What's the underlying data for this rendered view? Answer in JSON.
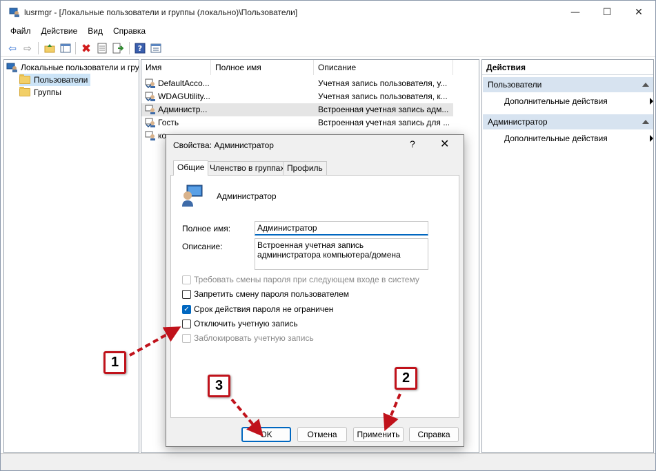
{
  "window": {
    "title": "lusrmgr - [Локальные пользователи и группы (локально)\\Пользователи]",
    "minimize": "—",
    "maximize": "☐",
    "close": "✕"
  },
  "menu": [
    "Файл",
    "Действие",
    "Вид",
    "Справка"
  ],
  "toolbar": {
    "icons": [
      "back-icon",
      "forward-icon",
      "up-folder-icon",
      "show-tree-icon",
      "delete-icon",
      "properties-icon",
      "export-icon",
      "help-icon",
      "view-icon"
    ]
  },
  "tree": {
    "root": "Локальные пользователи и гру",
    "items": [
      "Пользователи",
      "Группы"
    ]
  },
  "list": {
    "columns": [
      "Имя",
      "Полное имя",
      "Описание"
    ],
    "rows": [
      {
        "name": "DefaultAcco...",
        "fullname": "",
        "description": "Учетная запись пользователя, у..."
      },
      {
        "name": "WDAGUtility...",
        "fullname": "",
        "description": "Учетная запись пользователя, к..."
      },
      {
        "name": "Администр...",
        "fullname": "",
        "description": "Встроенная учетная запись адм..."
      },
      {
        "name": "Гость",
        "fullname": "",
        "description": "Встроенная учетная запись для ..."
      },
      {
        "name": "ко",
        "fullname": "",
        "description": ""
      }
    ]
  },
  "actions": {
    "title": "Действия",
    "sections": [
      {
        "header": "Пользователи",
        "item": "Дополнительные действия"
      },
      {
        "header": "Администратор",
        "item": "Дополнительные действия"
      }
    ]
  },
  "dialog": {
    "title": "Свойства: Администратор",
    "help": "?",
    "close": "✕",
    "tabs": [
      "Общие",
      "Членство в группах",
      "Профиль"
    ],
    "username": "Администратор",
    "fullname_label": "Полное имя:",
    "fullname_value": "Администратор",
    "description_label": "Описание:",
    "description_value": "Встроенная учетная запись администратора компьютера/домена",
    "checkboxes": [
      {
        "label": "Требовать смены пароля при следующем входе в систему",
        "checked": false,
        "disabled": true
      },
      {
        "label": "Запретить смену пароля пользователем",
        "checked": false,
        "disabled": false
      },
      {
        "label": "Срок действия пароля не ограничен",
        "checked": true,
        "disabled": false
      },
      {
        "label": "Отключить учетную запись",
        "checked": false,
        "disabled": false
      },
      {
        "label": "Заблокировать учетную запись",
        "checked": false,
        "disabled": true
      }
    ],
    "buttons": {
      "ok": "OK",
      "cancel": "Отмена",
      "apply": "Применить",
      "help": "Справка"
    }
  },
  "annotations": {
    "badge1": "1",
    "badge2": "2",
    "badge3": "3",
    "color": "#c0121b"
  }
}
